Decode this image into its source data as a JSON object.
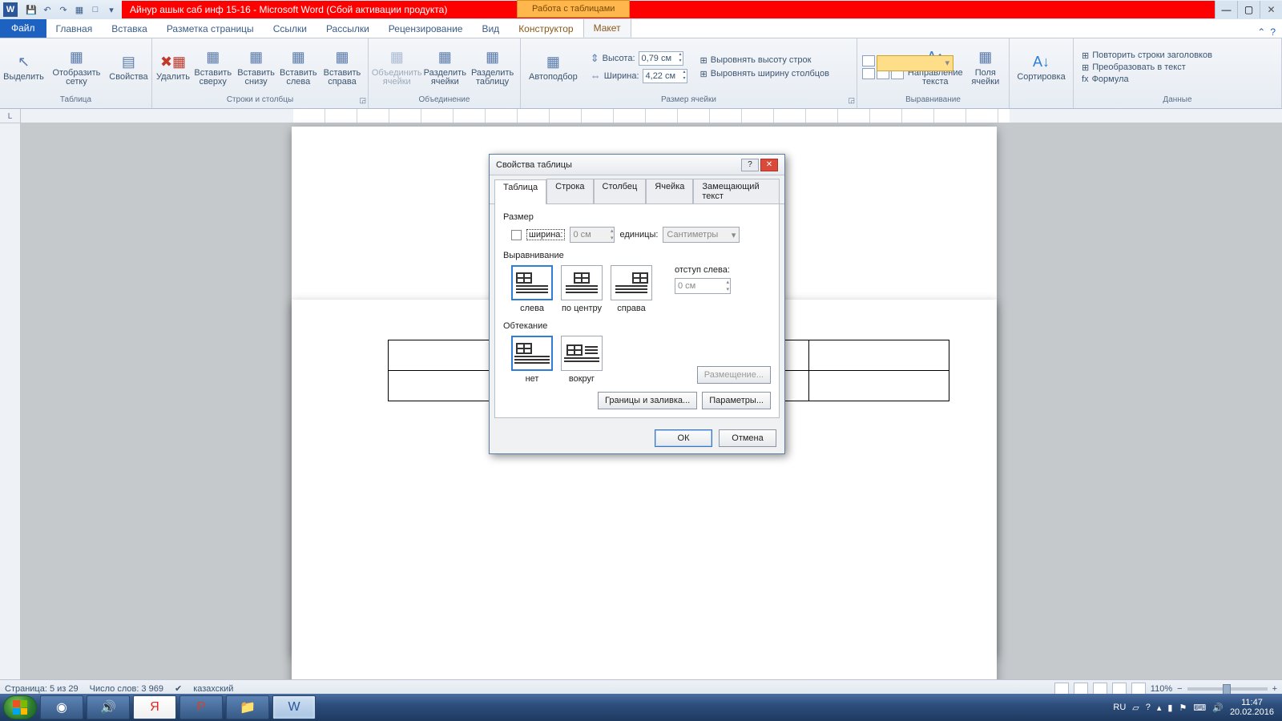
{
  "title_doc": "Айнур ашык саб инф 15-16  -  Microsoft Word (Сбой активации продукта)",
  "context_tab": "Работа с таблицами",
  "tabs": {
    "file": "Файл",
    "home": "Главная",
    "insert": "Вставка",
    "layout": "Разметка страницы",
    "refs": "Ссылки",
    "mail": "Рассылки",
    "review": "Рецензирование",
    "view": "Вид",
    "design": "Конструктор",
    "tlayout": "Макет"
  },
  "ribbon": {
    "select": "Выделить",
    "grid": "Отобразить сетку",
    "props": "Свойства",
    "delete": "Удалить",
    "ins_top": "Вставить сверху",
    "ins_bot": "Вставить снизу",
    "ins_left": "Вставить слева",
    "ins_right": "Вставить справа",
    "merge": "Объединить ячейки",
    "split": "Разделить ячейки",
    "split_t": "Разделить таблицу",
    "autofit": "Автоподбор",
    "height_l": "Высота:",
    "width_l": "Ширина:",
    "height_v": "0,79 см",
    "width_v": "4,22 см",
    "dist_h": "Выровнять высоту строк",
    "dist_w": "Выровнять ширину столбцов",
    "dir": "Направление текста",
    "margins": "Поля ячейки",
    "sort": "Сортировка",
    "repeat": "Повторить строки заголовков",
    "convert": "Преобразовать в текст",
    "formula": "Формула",
    "g_table": "Таблица",
    "g_rows": "Строки и столбцы",
    "g_merge": "Объединение",
    "g_size": "Размер ячейки",
    "g_align": "Выравнивание",
    "g_data": "Данные"
  },
  "dialog": {
    "title": "Свойства таблицы",
    "tabs": {
      "table": "Таблица",
      "row": "Строка",
      "col": "Столбец",
      "cell": "Ячейка",
      "alt": "Замещающий текст"
    },
    "size": "Размер",
    "width_l": "ширина:",
    "width_v": "0 см",
    "units_l": "единицы:",
    "units_v": "Сантиметры",
    "align": "Выравнивание",
    "a_left": "слева",
    "a_center": "по центру",
    "a_right": "справа",
    "indent_l": "отступ слева:",
    "indent_v": "0 см",
    "wrap": "Обтекание",
    "w_none": "нет",
    "w_around": "вокруг",
    "place": "Размещение...",
    "borders": "Границы и заливка...",
    "params": "Параметры...",
    "ok": "ОК",
    "cancel": "Отмена"
  },
  "status": {
    "page": "Страница: 5 из 29",
    "words": "Число слов: 3 969",
    "lang": "казахский",
    "zoom": "110%"
  },
  "tray": {
    "lang": "RU",
    "time": "11:47",
    "date": "20.02.2016"
  }
}
